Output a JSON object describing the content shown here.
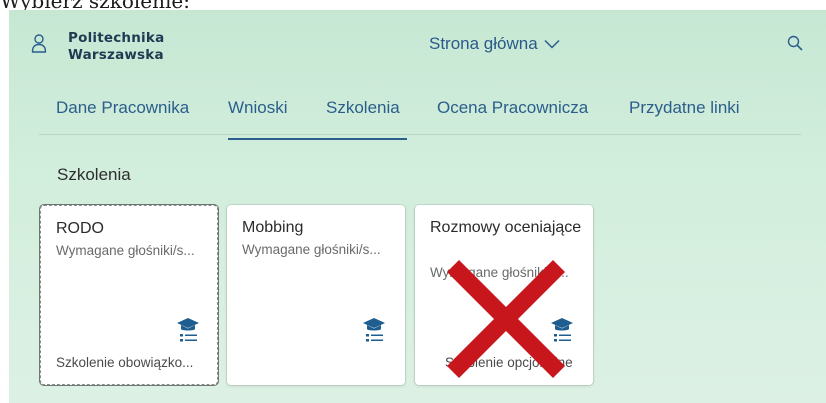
{
  "caption": "Wybierz szkolenie:",
  "header": {
    "logo_line1": "Politechnika",
    "logo_line2": "Warszawska",
    "page_switch": "Strona główna"
  },
  "tabs": [
    {
      "label": "Dane Pracownika"
    },
    {
      "label": "Wnioski",
      "selected": true
    },
    {
      "label": "Szkolenia"
    },
    {
      "label": "Ocena Pracownicza"
    },
    {
      "label": "Przydatne linki"
    }
  ],
  "section_title": "Szkolenia",
  "tiles": [
    {
      "title": "RODO",
      "subtitle": "Wymagane głośniki/s...",
      "footer": "Szkolenie obowiązko...",
      "icon": "training-list-icon"
    },
    {
      "title": "Mobbing",
      "subtitle": "Wymagane głośniki/s...",
      "footer": "",
      "icon": "training-list-icon"
    },
    {
      "title": "Rozmowy oceniające",
      "subtitle": "Wymagane głośniki/s...",
      "footer": "Szkolenie opcjonalne",
      "icon": "training-list-icon",
      "crossed_out": true
    }
  ],
  "colors": {
    "accent": "#2b5e8c",
    "icon": "#1d5d8f",
    "cross": "#c8161d",
    "background": "#cdebd8"
  }
}
